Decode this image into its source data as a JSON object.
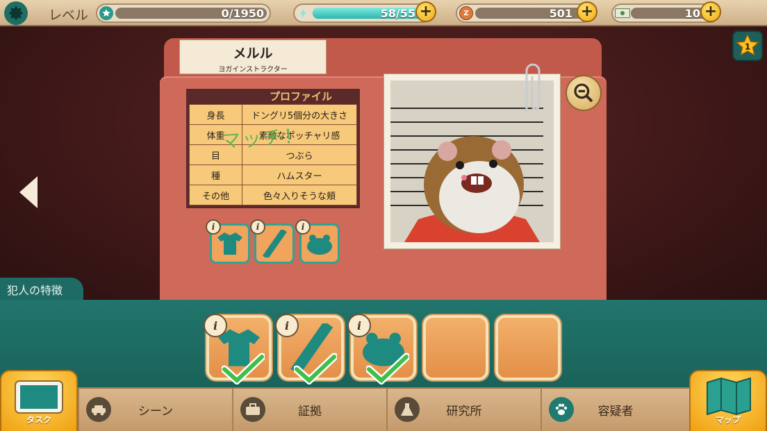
{
  "topbar": {
    "level_label": "レベル",
    "xp_value": "0/1950",
    "xp_progress": 0,
    "energy_value": "58/55",
    "energy_progress": 1.0,
    "coins_value": "501",
    "cash_value": "10"
  },
  "star_badge": "1",
  "suspect": {
    "name": "メルル",
    "role": "ヨガインストラクター"
  },
  "profile": {
    "title": "プロファイル",
    "rows": [
      {
        "key": "身長",
        "value": "ドングリ5個分の大きさ"
      },
      {
        "key": "体重",
        "value": "素敵なポッチャリ感"
      },
      {
        "key": "目",
        "value": "つぶら"
      },
      {
        "key": "種",
        "value": "ハムスター"
      },
      {
        "key": "その他",
        "value": "色々入りそうな頬"
      }
    ]
  },
  "match_text": "マッチ！",
  "traits_label": "犯人の特徴",
  "trait_slots": [
    {
      "icon": "shirt-icon",
      "matched": true
    },
    {
      "icon": "ruler-icon",
      "matched": true
    },
    {
      "icon": "hamster-icon",
      "matched": true
    },
    {
      "icon": "",
      "matched": false
    },
    {
      "icon": "",
      "matched": false
    }
  ],
  "info_symbol": "i",
  "nav": {
    "tasks": "タスク",
    "scene": "シーン",
    "evidence": "証拠",
    "lab": "研究所",
    "suspects": "容疑者",
    "map": "マップ"
  },
  "colors": {
    "teal": "#21756c",
    "folder": "#cf6a5a",
    "gold": "#f0a914"
  }
}
